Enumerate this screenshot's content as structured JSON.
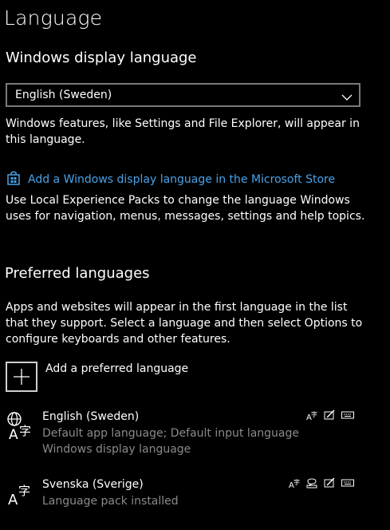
{
  "page": {
    "title": "Language"
  },
  "display_language": {
    "heading": "Windows display language",
    "selected": "English (Sweden)",
    "description": "Windows features, like Settings and File Explorer, will appear in this language.",
    "store_link": "Add a Windows display language in the Microsoft Store",
    "store_icon": "store-icon",
    "lxp_note": "Use Local Experience Packs to change the language Windows uses for navigation, menus, messages, settings and help topics."
  },
  "preferred": {
    "heading": "Preferred languages",
    "description": "Apps and websites will appear in the first language in the list that they support. Select a language and then select Options to configure keyboards and other features.",
    "add_label": "Add a preferred language",
    "languages": [
      {
        "name": "English (Sweden)",
        "sub1": "Default app language; Default input language",
        "sub2": "Windows display language",
        "features": [
          "language-pack-icon",
          "handwriting-icon",
          "keyboard-icon"
        ]
      },
      {
        "name": "Svenska (Sverige)",
        "sub1": "Language pack installed",
        "features": [
          "language-pack-icon",
          "speech-icon",
          "handwriting-icon",
          "keyboard-icon"
        ]
      }
    ]
  },
  "colors": {
    "accent": "#4aa2e8",
    "secondary_text": "#8a8a8a",
    "background": "#000000"
  }
}
